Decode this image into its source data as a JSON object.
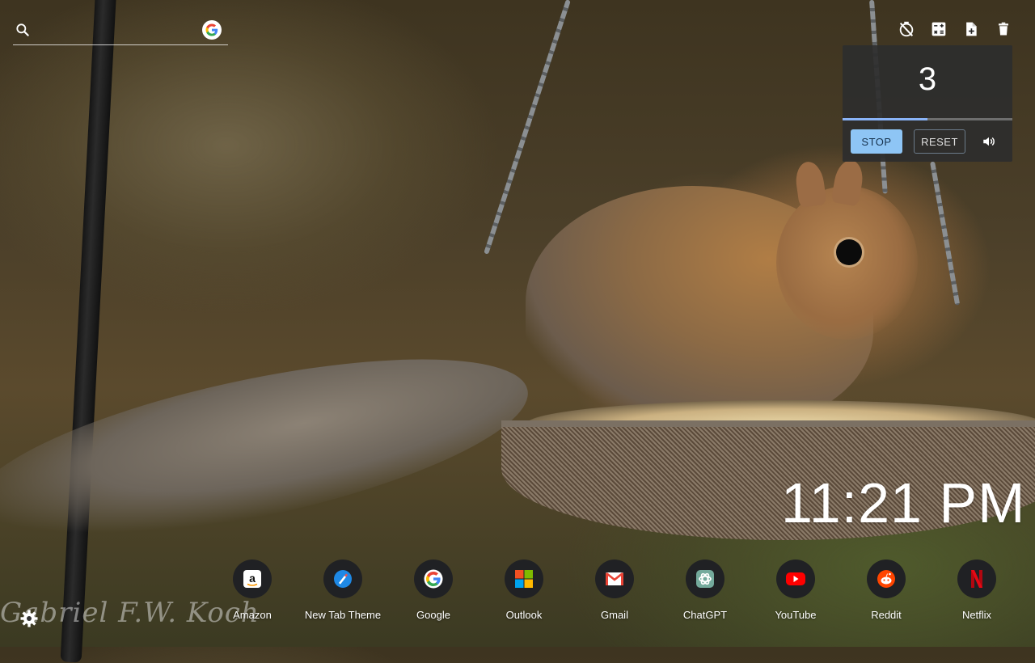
{
  "search": {
    "placeholder": "",
    "value": "",
    "engine_icon": "google-icon"
  },
  "toolbar_icons": [
    "timer-off-icon",
    "calculator-icon",
    "note-add-icon",
    "delete-icon"
  ],
  "timer": {
    "count": "3",
    "progress": 0.5,
    "stop_label": "STOP",
    "reset_label": "RESET",
    "volume_icon": "volume-icon"
  },
  "clock": {
    "time": "11:21 PM"
  },
  "shortcuts": [
    {
      "label": "Amazon",
      "icon": "amazon-icon"
    },
    {
      "label": "New Tab Theme",
      "icon": "new-tab-theme-icon"
    },
    {
      "label": "Google",
      "icon": "google-icon"
    },
    {
      "label": "Outlook",
      "icon": "outlook-icon"
    },
    {
      "label": "Gmail",
      "icon": "gmail-icon"
    },
    {
      "label": "ChatGPT",
      "icon": "chatgpt-icon"
    },
    {
      "label": "YouTube",
      "icon": "youtube-icon"
    },
    {
      "label": "Reddit",
      "icon": "reddit-icon"
    },
    {
      "label": "Netflix",
      "icon": "netflix-icon"
    }
  ],
  "watermark": "Gabriel F.W. Koch",
  "colors": {
    "accent": "#8ec5f5",
    "progress": "#8ab4f8",
    "panel": "#2d2d2d"
  }
}
